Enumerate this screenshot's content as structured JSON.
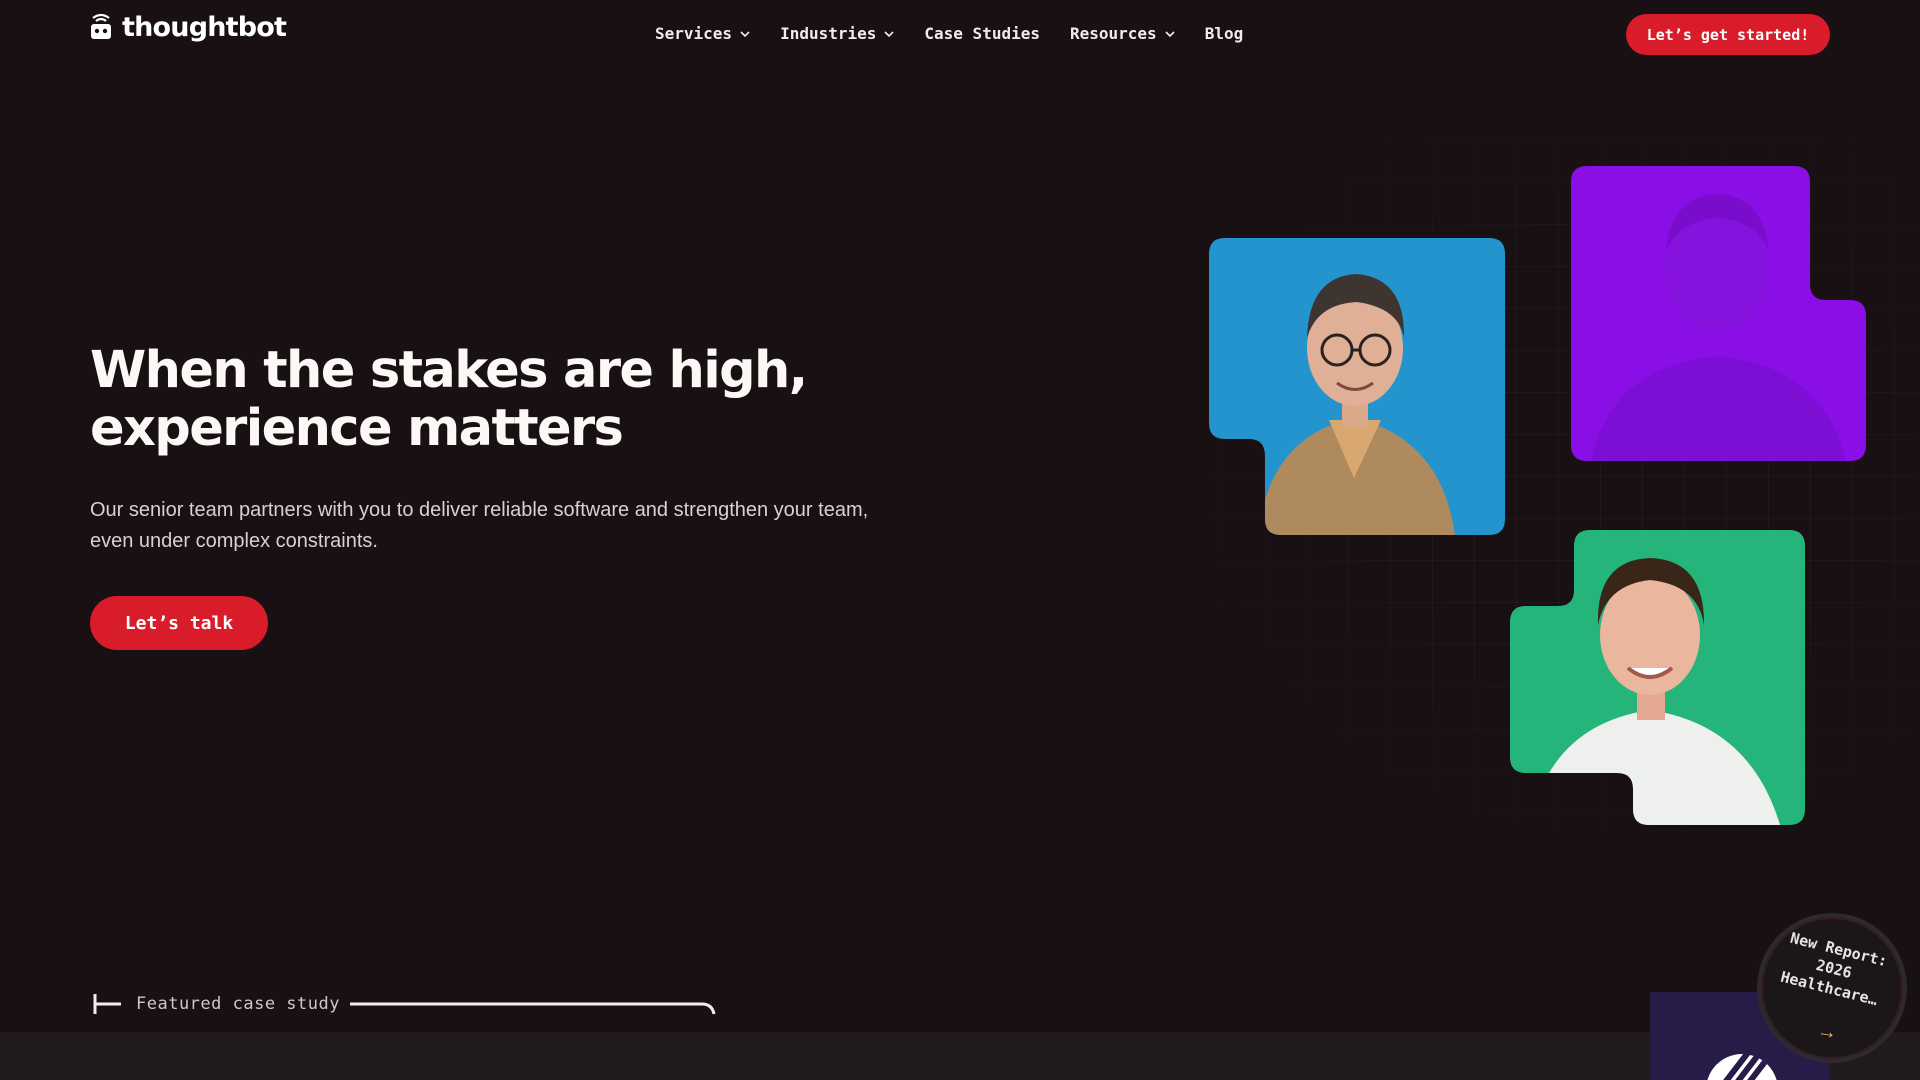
{
  "brand": {
    "name": "thoughtbot"
  },
  "nav": {
    "items": [
      {
        "label": "Services",
        "has_dropdown": true
      },
      {
        "label": "Industries",
        "has_dropdown": true
      },
      {
        "label": "Case Studies",
        "has_dropdown": false
      },
      {
        "label": "Resources",
        "has_dropdown": true
      },
      {
        "label": "Blog",
        "has_dropdown": false
      }
    ],
    "cta_label": "Let’s get started!"
  },
  "hero": {
    "title": "When the stakes are high, experience matters",
    "subtitle": "Our senior team partners with you to deliver reliable software and strengthen your team, even under complex constraints.",
    "cta_label": "Let’s talk"
  },
  "photos": [
    {
      "name": "portrait-blue",
      "bg_color": "#2494cf"
    },
    {
      "name": "portrait-purple",
      "bg_color": "#8a0fe6"
    },
    {
      "name": "portrait-green",
      "bg_color": "#25b57a"
    }
  ],
  "featured": {
    "label": "Featured case study"
  },
  "report_badge": {
    "text": "New Report: 2026 Healthcare…",
    "arrow": "→"
  },
  "colors": {
    "accent": "#d91c2a",
    "background": "#181012"
  }
}
